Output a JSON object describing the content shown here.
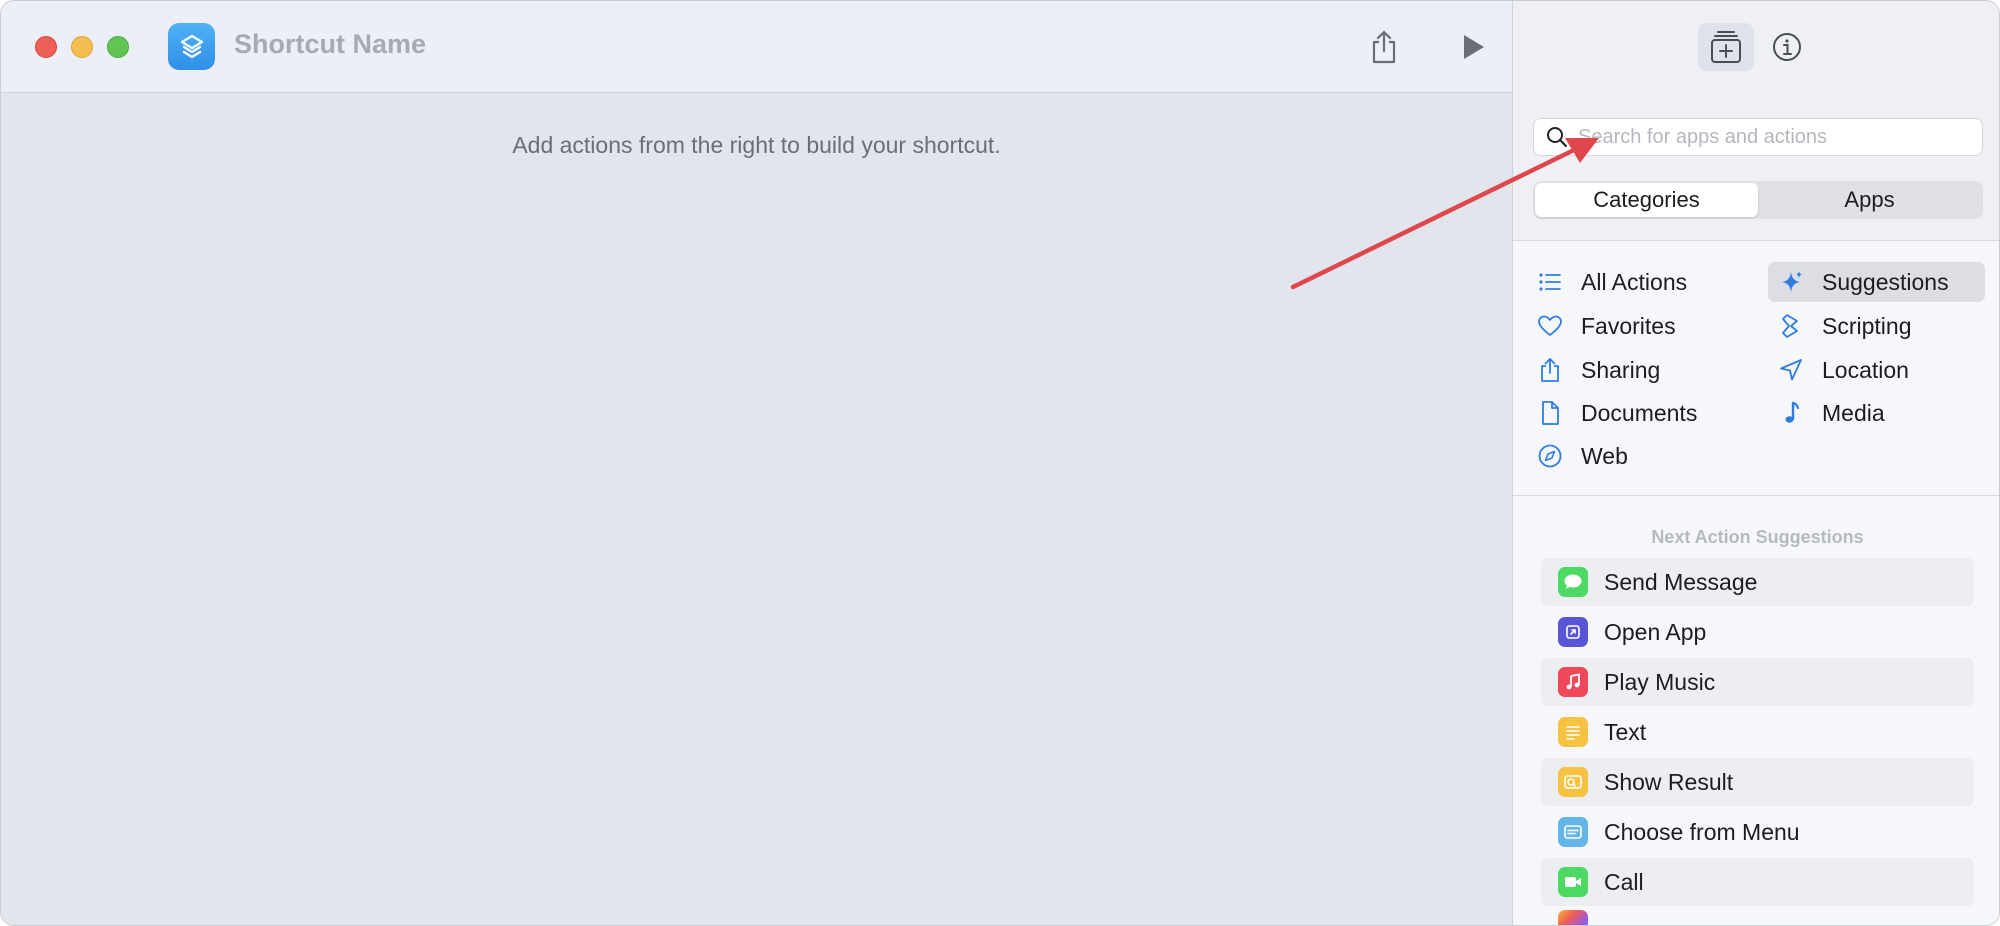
{
  "titlebar": {
    "shortcut_name": "Shortcut Name"
  },
  "editor": {
    "empty_hint": "Add actions from the right to build your shortcut."
  },
  "sidebar": {
    "search": {
      "placeholder": "Search for apps and actions",
      "value": ""
    },
    "segments": [
      "Categories",
      "Apps"
    ],
    "active_segment": "Categories",
    "categories": [
      {
        "label": "All Actions",
        "icon": "list-icon"
      },
      {
        "label": "Suggestions",
        "icon": "sparkle-icon"
      },
      {
        "label": "Favorites",
        "icon": "heart-icon"
      },
      {
        "label": "Scripting",
        "icon": "scripting-icon"
      },
      {
        "label": "Sharing",
        "icon": "share-icon"
      },
      {
        "label": "Location",
        "icon": "location-arrow-icon"
      },
      {
        "label": "Documents",
        "icon": "document-icon"
      },
      {
        "label": "Media",
        "icon": "music-note-icon"
      },
      {
        "label": "Web",
        "icon": "compass-icon"
      }
    ],
    "selected_category": "Suggestions",
    "suggestions_header": "Next Action Suggestions",
    "suggestions": [
      {
        "label": "Send Message",
        "icon": "messages-icon",
        "color": "#4cd964"
      },
      {
        "label": "Open App",
        "icon": "open-app-icon",
        "color": "#5856d6"
      },
      {
        "label": "Play Music",
        "icon": "music-icon",
        "color": "#f0485a"
      },
      {
        "label": "Text",
        "icon": "text-icon",
        "color": "#f5c242"
      },
      {
        "label": "Show Result",
        "icon": "show-result-icon",
        "color": "#f5c242"
      },
      {
        "label": "Choose from Menu",
        "icon": "menu-icon",
        "color": "#64b5e8"
      },
      {
        "label": "Call",
        "icon": "facetime-icon",
        "color": "#4cd964"
      }
    ]
  },
  "colors": {
    "accent": "#2f7de1",
    "annotation_arrow": "#e0474c"
  }
}
